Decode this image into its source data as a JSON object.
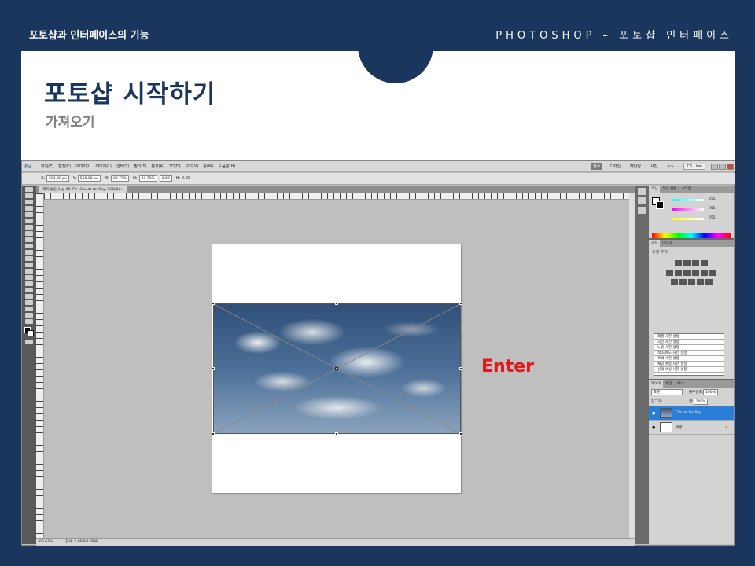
{
  "slide": {
    "top_left": "포토샵과 인터페이스의 기능",
    "top_right": "PHOTOSHOP –  포토샵 인터페이스",
    "title": "포토샵 시작하기",
    "subtitle": "가져오기",
    "annotation": "Enter"
  },
  "colors": {
    "navy": "#1b365d",
    "annotation_red": "#e3161b",
    "layer_selected": "#2a7ed8"
  },
  "photoshop": {
    "logo": "Ps",
    "menu": [
      "파일(F)",
      "편집(E)",
      "이미지(I)",
      "레이어(L)",
      "선택(S)",
      "필터(T)",
      "분석(A)",
      "3D(D)",
      "보기(V)",
      "창(W)",
      "도움말(H)"
    ],
    "workspaces": [
      "필수",
      "디자인",
      "페인팅",
      "사진",
      ">>"
    ],
    "cs_live": "CS Live",
    "options": {
      "x_label": "X:",
      "x_value": "501.00 px",
      "y_label": "Y:",
      "y_value": "500.00 px",
      "w_label": "W:",
      "w_value": "89.77%",
      "h_label": "H:",
      "h_value": "89.73%",
      "angle_value": "0.00",
      "interp_label": "H: 0.00"
    },
    "doc_tab": "제목 없음-1 @ 66.7% (Clouds for Sky, RGB/8) ×",
    "status": {
      "zoom": "66.67%",
      "doc_size": "문서: 2.86M/2.38M"
    },
    "color_panel": {
      "tabs": [
        "색상",
        "색상 견본",
        "스타일"
      ],
      "values": [
        "255",
        "255",
        "255"
      ]
    },
    "adjust_panel": {
      "tabs": [
        "조정",
        "마스크"
      ],
      "title": "조정 추가",
      "presets": [
        "레벨 사전 설정",
        "곡선 사전 설정",
        "노출 사전 설정",
        "색조/채도 사전 설정",
        "흑백 사전 설정",
        "채널 혼합 사전 설정",
        "선택 색상 사전 설정"
      ]
    },
    "layers_panel": {
      "tabs": [
        "레이어",
        "채널",
        "패스"
      ],
      "blend_mode": "표준",
      "opacity_label": "불투명도:",
      "opacity_value": "100%",
      "lock_label": "잠그기:",
      "fill_label": "칠:",
      "fill_value": "100%",
      "layers": [
        {
          "name": "Clouds for Sky",
          "selected": true
        },
        {
          "name": "배경",
          "selected": false
        }
      ]
    },
    "icons": [
      "move-tool-icon",
      "marquee-tool-icon",
      "lasso-tool-icon",
      "quick-select-icon",
      "crop-tool-icon",
      "eyedropper-icon",
      "brush-tool-icon",
      "eye-icon",
      "lock-icon"
    ]
  }
}
